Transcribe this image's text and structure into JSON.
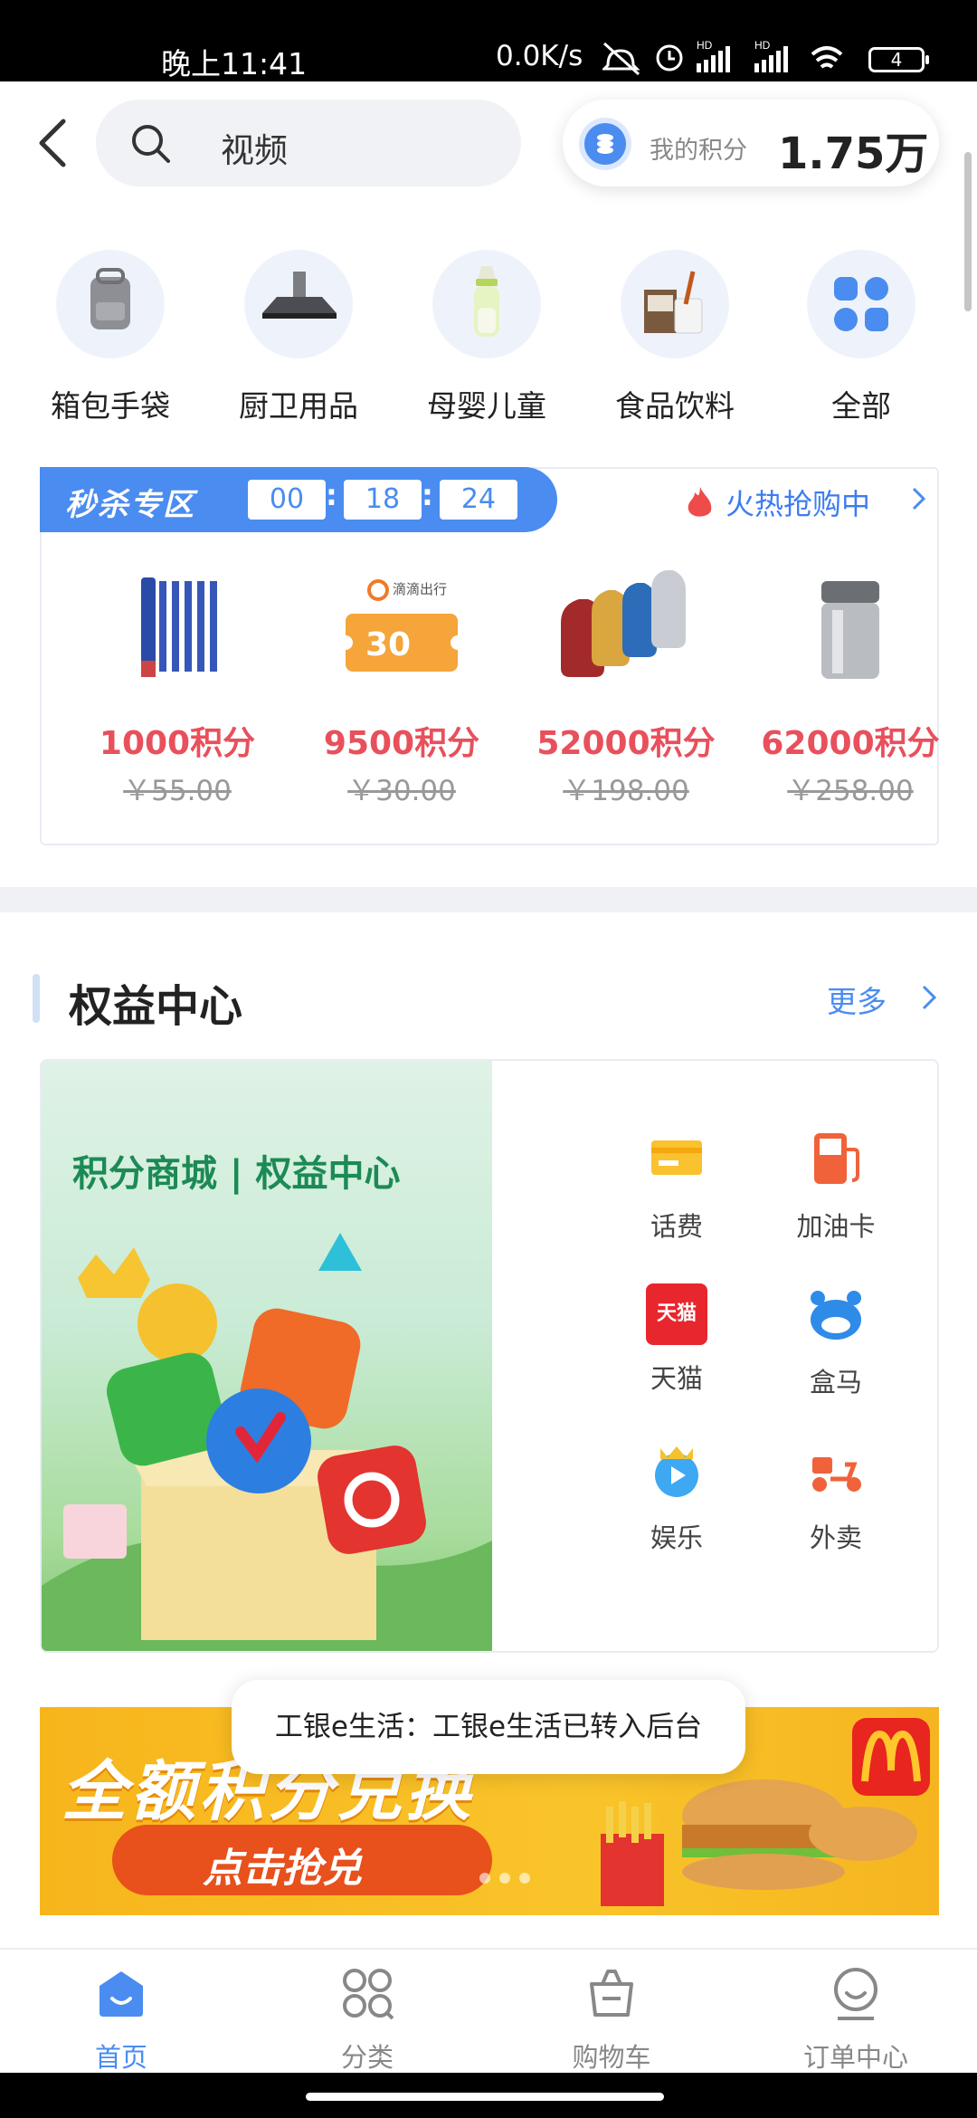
{
  "status_bar": {
    "time": "晚上11:41",
    "net_speed": "0.0K/s",
    "battery": "4"
  },
  "header": {
    "search_label": "视频",
    "points_label": "我的积分",
    "points_value": "1.75万"
  },
  "categories": [
    {
      "name": "箱包手袋",
      "icon": "bag-icon"
    },
    {
      "name": "厨卫用品",
      "icon": "range-hood-icon"
    },
    {
      "name": "母婴儿童",
      "icon": "baby-bottle-icon"
    },
    {
      "name": "食品饮料",
      "icon": "drinks-icon"
    },
    {
      "name": "全部",
      "icon": "all-categories-icon"
    }
  ],
  "flash_sale": {
    "title": "秒杀专区",
    "countdown": {
      "h": "00",
      "m": "18",
      "s": "24"
    },
    "hot_label": "火热抢购中",
    "products": [
      {
        "price": "1000积分",
        "original": "￥55.00",
        "icon": "pencils-icon"
      },
      {
        "price": "9500积分",
        "original": "￥30.00",
        "icon": "didi-coupon-icon",
        "coupon_brand": "滴滴出行",
        "coupon_value": "30"
      },
      {
        "price": "52000积分",
        "original": "￥198.00",
        "icon": "kettles-icon"
      },
      {
        "price": "62000积分",
        "original": "￥258.00",
        "icon": "thermos-icon"
      }
    ]
  },
  "rights_center": {
    "title": "权益中心",
    "more_label": "更多",
    "banner_title": "积分商城 | 权益中心",
    "items": [
      {
        "name": "话费",
        "icon": "phone-bill-icon"
      },
      {
        "name": "加油卡",
        "icon": "fuel-card-icon"
      },
      {
        "name": "天猫",
        "icon": "tmall-icon",
        "badge": "天猫"
      },
      {
        "name": "盒马",
        "icon": "hema-icon"
      },
      {
        "name": "娱乐",
        "icon": "entertainment-icon"
      },
      {
        "name": "外卖",
        "icon": "delivery-icon"
      }
    ]
  },
  "promo": {
    "headline": "全额积分兑换",
    "button": "点击抢兑"
  },
  "toast": "工银e生活：工银e生活已转入后台",
  "bottom_nav": [
    {
      "label": "首页",
      "icon": "home-icon",
      "active": true
    },
    {
      "label": "分类",
      "icon": "category-icon",
      "active": false
    },
    {
      "label": "购物车",
      "icon": "cart-icon",
      "active": false
    },
    {
      "label": "订单中心",
      "icon": "order-center-icon",
      "active": false
    }
  ],
  "colors": {
    "accent": "#4a8cf0",
    "price_red": "#e8505c",
    "promo_yellow": "#f9c42a"
  }
}
